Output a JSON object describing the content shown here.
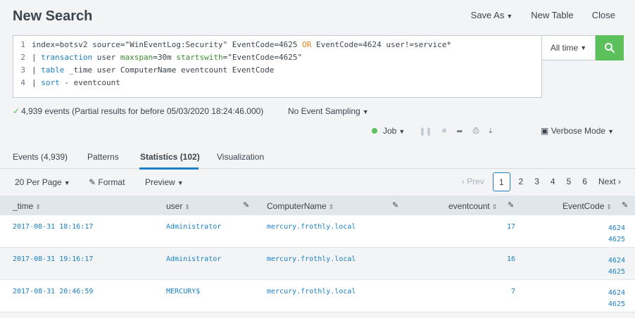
{
  "page": {
    "title": "New Search"
  },
  "actions": {
    "save_as": "Save As",
    "new_table": "New Table",
    "close": "Close"
  },
  "search": {
    "lines": [
      {
        "num": "1",
        "parts": [
          {
            "t": "index=botsv2 source=\"WinEventLog:Security\" EventCode=4625 ",
            "c": ""
          },
          {
            "t": "OR",
            "c": "kw"
          },
          {
            "t": " EventCode=4624 user!=service*",
            "c": ""
          }
        ]
      },
      {
        "num": "2",
        "parts": [
          {
            "t": "| ",
            "c": "pipe"
          },
          {
            "t": "transaction",
            "c": "cmd"
          },
          {
            "t": " user ",
            "c": ""
          },
          {
            "t": "maxspan",
            "c": "arg"
          },
          {
            "t": "=30m ",
            "c": ""
          },
          {
            "t": "startswith",
            "c": "arg"
          },
          {
            "t": "=\"EventCode=4625\"",
            "c": ""
          }
        ]
      },
      {
        "num": "3",
        "parts": [
          {
            "t": "| ",
            "c": "pipe"
          },
          {
            "t": "table",
            "c": "cmd"
          },
          {
            "t": " _time user ComputerName eventcount EventCode",
            "c": ""
          }
        ]
      },
      {
        "num": "4",
        "parts": [
          {
            "t": "| ",
            "c": "pipe"
          },
          {
            "t": "sort",
            "c": "cmd"
          },
          {
            "t": " - eventcount",
            "c": ""
          }
        ]
      }
    ],
    "time_range": "All time"
  },
  "status": {
    "summary": "4,939 events (Partial results for before 05/03/2020 18:24:46.000)",
    "sampling": "No Event Sampling"
  },
  "job": {
    "label": "Job",
    "mode": "Verbose Mode"
  },
  "tabs": [
    {
      "label": "Events (4,939)"
    },
    {
      "label": "Patterns"
    },
    {
      "label": "Statistics (102)"
    },
    {
      "label": "Visualization"
    }
  ],
  "toolbar": {
    "per_page": "20 Per Page",
    "format": "Format",
    "preview": "Preview"
  },
  "pager": {
    "prev": "Prev",
    "pages": [
      "1",
      "2",
      "3",
      "4",
      "5",
      "6"
    ],
    "next": "Next"
  },
  "columns": {
    "time": "_time",
    "user": "user",
    "computer": "ComputerName",
    "eventcount": "eventcount",
    "eventcode": "EventCode"
  },
  "rows": [
    {
      "time": "2017-08-31 18:16:17",
      "user": "Administrator",
      "computer": "mercury.frothly.local",
      "eventcount": "17",
      "codes": [
        "4624",
        "4625"
      ]
    },
    {
      "time": "2017-08-31 19:16:17",
      "user": "Administrator",
      "computer": "mercury.frothly.local",
      "eventcount": "16",
      "codes": [
        "4624",
        "4625"
      ]
    },
    {
      "time": "2017-08-31 20:46:59",
      "user": "MERCURY$",
      "computer": "mercury.frothly.local",
      "eventcount": "7",
      "codes": [
        "4624",
        "4625"
      ]
    }
  ]
}
